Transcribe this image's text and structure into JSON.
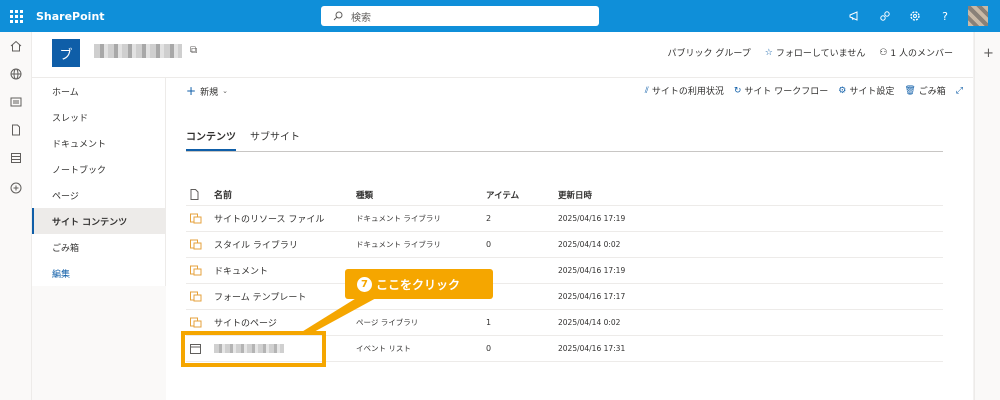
{
  "suite": {
    "brand": "SharePoint",
    "search_placeholder": "検索"
  },
  "site": {
    "logo_letter": "ブ",
    "group_type": "パブリック グループ",
    "follow": "フォローしていません",
    "members": "1 人のメンバー"
  },
  "nav": {
    "items": [
      "ホーム",
      "スレッド",
      "ドキュメント",
      "ノートブック",
      "ページ",
      "サイト コンテンツ",
      "ごみ箱"
    ],
    "selected_index": 5,
    "edit_label": "編集"
  },
  "commands": {
    "new_label": "新規",
    "usage": "サイトの利用状況",
    "workflows": "サイト ワークフロー",
    "settings": "サイト設定",
    "recycle": "ごみ箱"
  },
  "tabs": [
    "コンテンツ",
    "サブサイト"
  ],
  "table": {
    "headers": {
      "name": "名前",
      "type": "種類",
      "items": "アイテム",
      "modified": "更新日時"
    },
    "rows": [
      {
        "name": "サイトのリソース ファイル",
        "type": "ドキュメント ライブラリ",
        "items": "2",
        "modified": "2025/04/16 17:19"
      },
      {
        "name": "スタイル ライブラリ",
        "type": "ドキュメント ライブラリ",
        "items": "0",
        "modified": "2025/04/14 0:02"
      },
      {
        "name": "ドキュメント",
        "type": "",
        "items": "",
        "modified": "2025/04/16 17:19"
      },
      {
        "name": "フォーム テンプレート",
        "type": "",
        "items": "",
        "modified": "2025/04/16 17:17"
      },
      {
        "name": "サイトのページ",
        "type": "ページ ライブラリ",
        "items": "1",
        "modified": "2025/04/14 0:02"
      },
      {
        "name": "",
        "type": "イベント リスト",
        "items": "0",
        "modified": "2025/04/16 17:31"
      }
    ]
  },
  "annotation": {
    "number": "7",
    "text": "ここをクリック"
  },
  "colors": {
    "suitebar": "#0f8fd9",
    "accent": "#0f5ea8",
    "annotation": "#f5a600"
  }
}
